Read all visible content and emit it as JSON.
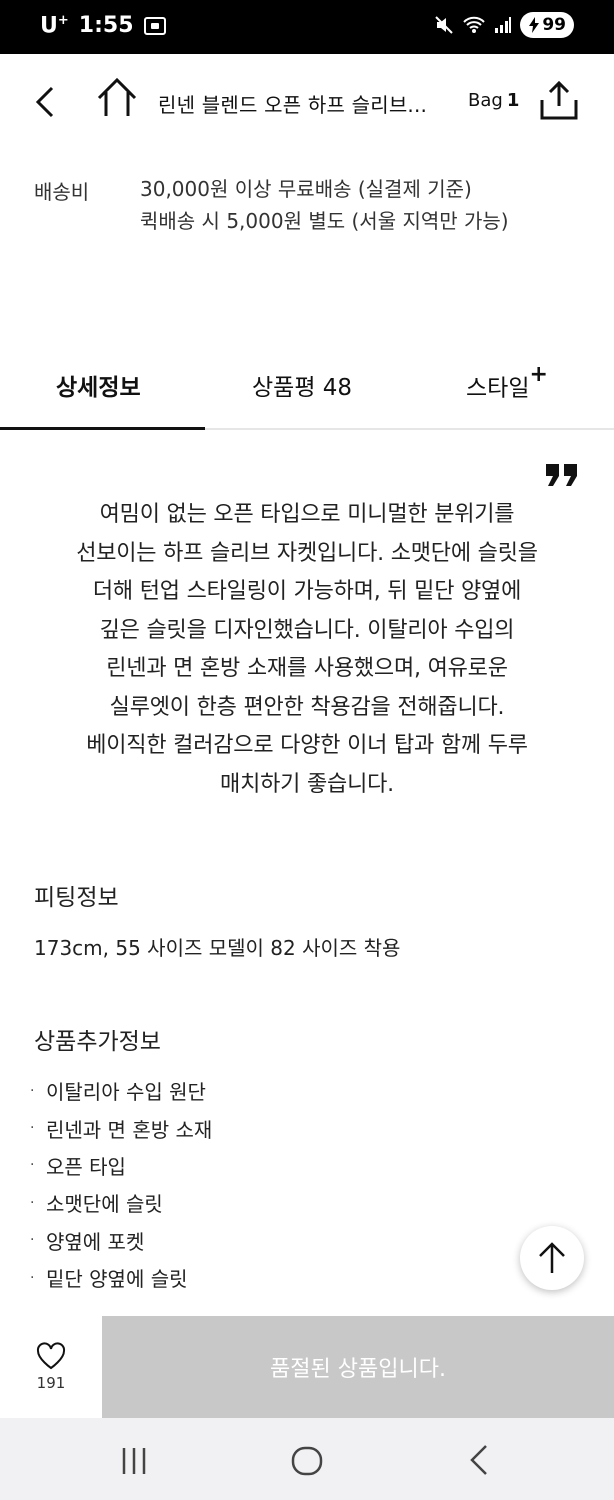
{
  "status_bar": {
    "carrier": "U",
    "carrier_sup": "+",
    "time": "1:55",
    "battery": "99"
  },
  "header": {
    "title": "린넨 블렌드 오픈 하프 슬리브...",
    "bag_label": "Bag",
    "bag_count": "1"
  },
  "delivery": {
    "label": "배송비",
    "lines": [
      "30,000원 이상 무료배송 (실결제 기준)",
      "퀵배송 시 5,000원 별도 (서울 지역만 가능)"
    ]
  },
  "tabs": {
    "detail": "상세정보",
    "review": "상품평 48",
    "style": "스타일",
    "style_plus": "+"
  },
  "description": [
    "여밈이 없는 오픈 타입으로 미니멀한 분위기를",
    "선보이는 하프 슬리브 자켓입니다. 소맷단에 슬릿을",
    "더해 턴업 스타일링이 가능하며, 뒤 밑단 양옆에",
    "깊은 슬릿을 디자인했습니다. 이탈리아 수입의",
    "린넨과 면 혼방 소재를 사용했으며, 여유로운",
    "실루엣이 한층 편안한 착용감을 전해줍니다.",
    "베이직한 컬러감으로 다양한 이너 탑과 함께 두루",
    "매치하기 좋습니다."
  ],
  "fitting": {
    "title": "피팅정보",
    "text": "173cm, 55 사이즈 모델이 82 사이즈 착용"
  },
  "extra_info": {
    "title": "상품추가정보",
    "bullet": "·",
    "items": [
      "이탈리아 수입 원단",
      "린넨과 면 혼방 소재",
      "오픈 타입",
      "소맷단에 슬릿",
      "양옆에 포켓",
      "밑단 양옆에 슬릿"
    ]
  },
  "bottom_bar": {
    "like_count": "191",
    "soldout_label": "품절된 상품입니다."
  },
  "colors": {
    "soldout_bg": "#c8c8c8",
    "text": "#111111",
    "navbar_bg": "#f1f1f3"
  }
}
